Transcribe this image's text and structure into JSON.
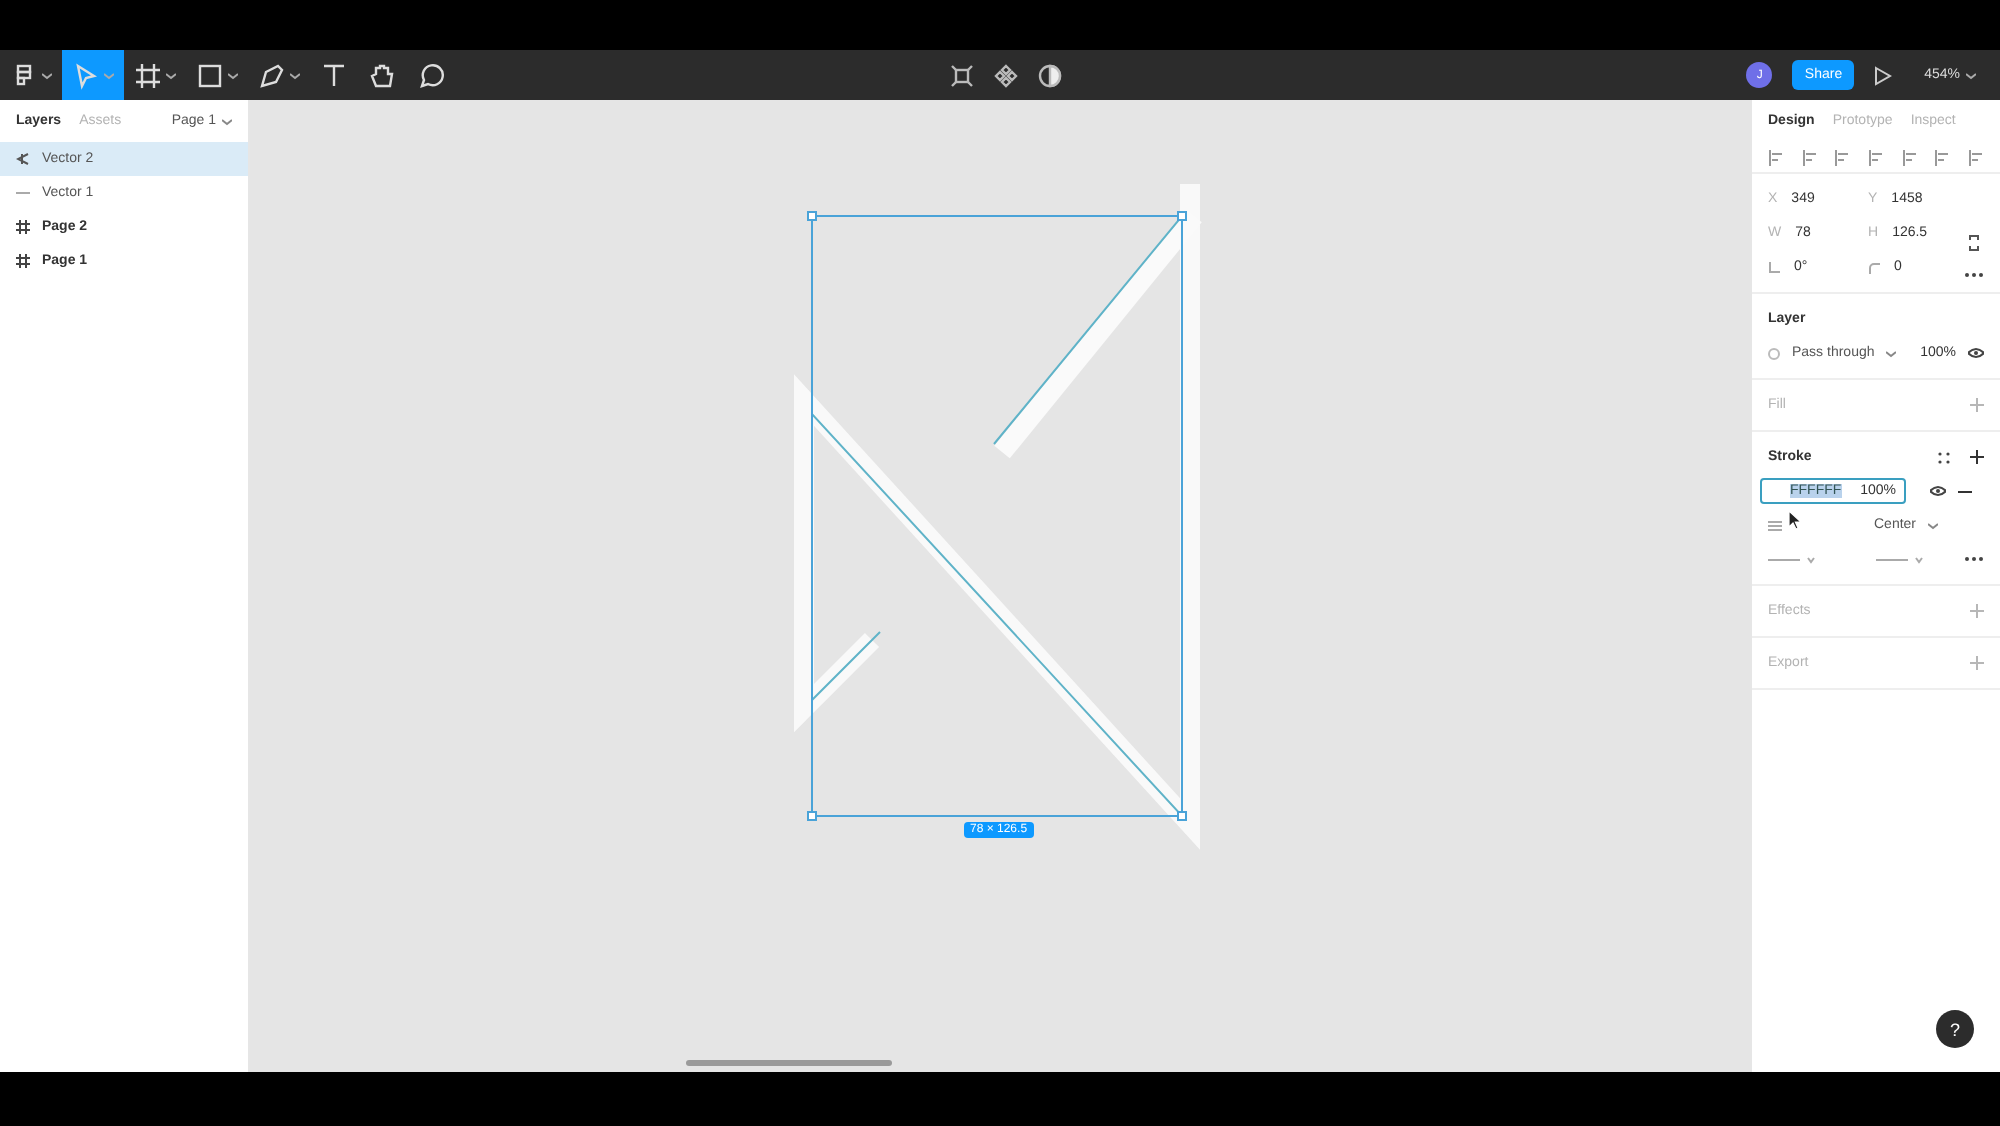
{
  "toolbar": {
    "tools": [
      {
        "kind": "menu",
        "selected": false
      },
      {
        "kind": "move",
        "selected": true
      },
      {
        "kind": "frame",
        "selected": false
      },
      {
        "kind": "shape",
        "selected": false
      },
      {
        "kind": "pen",
        "selected": false
      },
      {
        "kind": "text",
        "selected": false
      },
      {
        "kind": "hand",
        "selected": false
      },
      {
        "kind": "comment",
        "selected": false
      }
    ],
    "center_tools": [
      {
        "kind": "crop"
      },
      {
        "kind": "component"
      },
      {
        "kind": "mask"
      }
    ],
    "avatar": "J",
    "share": "Share",
    "zoom": "454%"
  },
  "left_panel": {
    "tabs": [
      {
        "label": "Layers",
        "selected": true
      },
      {
        "label": "Assets",
        "selected": false
      }
    ],
    "page": "Page 1",
    "layers": [
      {
        "kind": "vector",
        "name": "Vector 2",
        "selected": true
      },
      {
        "kind": "line",
        "name": "Vector 1",
        "selected": false
      },
      {
        "kind": "frame",
        "name": "Page 2",
        "selected": false
      },
      {
        "kind": "frame",
        "name": "Page 1",
        "selected": false
      }
    ]
  },
  "canvas": {
    "selection_size": "78 × 126.5"
  },
  "right_panel": {
    "tabs": [
      {
        "label": "Design",
        "selected": true
      },
      {
        "label": "Prototype",
        "selected": false
      },
      {
        "label": "Inspect",
        "selected": false
      }
    ],
    "fields": [
      {
        "label": "X",
        "value": "349"
      },
      {
        "label": "Y",
        "value": "1458"
      },
      {
        "label": "W",
        "value": "78"
      },
      {
        "label": "H",
        "value": "126.5"
      },
      {
        "kind": "rotation",
        "value": "0°"
      },
      {
        "kind": "radius",
        "value": "0"
      }
    ],
    "sections": [
      {
        "kind": "layer",
        "title": "Layer",
        "empty": false,
        "blend": "Pass through",
        "opacity": "100%"
      },
      {
        "kind": "fill",
        "title": "Fill",
        "empty": true
      },
      {
        "kind": "stroke",
        "title": "Stroke",
        "empty": false,
        "hex": "FFFFFF",
        "opacity": "100%",
        "position": "Center"
      },
      {
        "kind": "effects",
        "title": "Effects",
        "empty": true
      },
      {
        "kind": "export",
        "title": "Export",
        "empty": true
      }
    ],
    "help": "?"
  }
}
